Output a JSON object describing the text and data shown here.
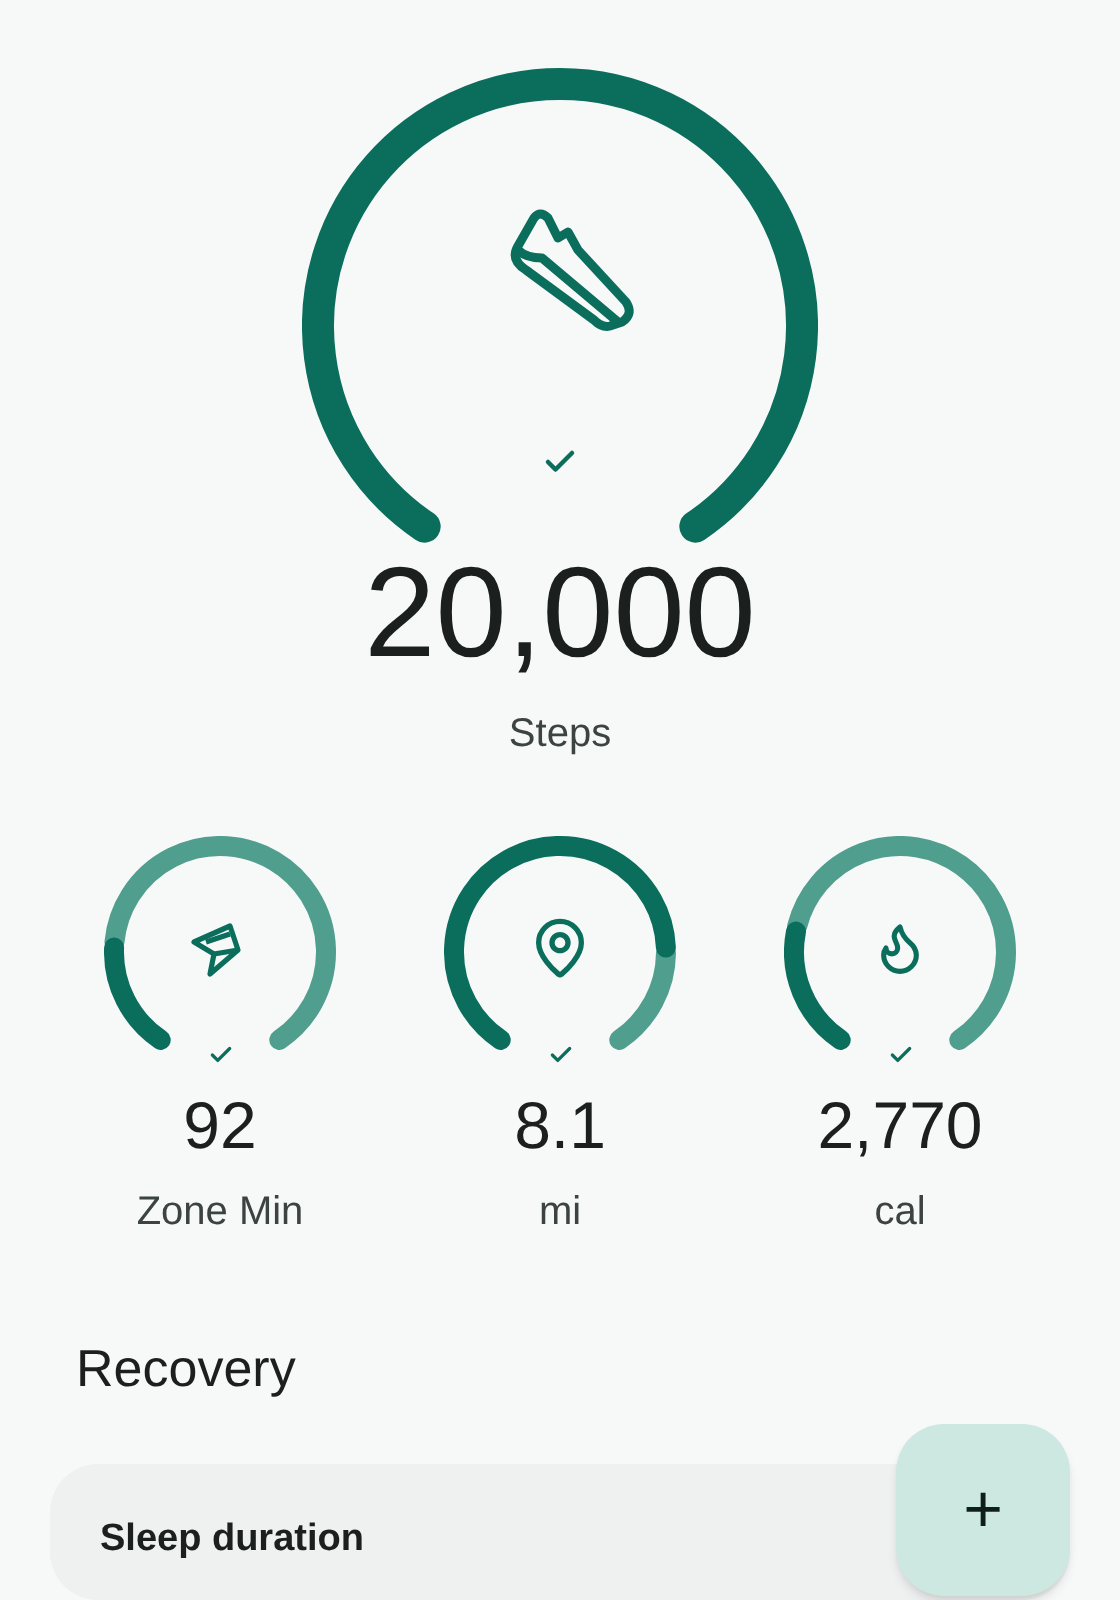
{
  "main_goal": {
    "value": "20,000",
    "label": "Steps",
    "goal_met": true
  },
  "metrics": [
    {
      "kind": "zone",
      "value": "92",
      "label": "Zone Min",
      "goal_met": true
    },
    {
      "kind": "distance",
      "value": "8.1",
      "label": "mi",
      "goal_met": true
    },
    {
      "kind": "calories",
      "value": "2,770",
      "label": "cal",
      "goal_met": true
    }
  ],
  "section_title": "Recovery",
  "cards": [
    {
      "title": "Sleep duration"
    }
  ],
  "fab": {
    "label": "+"
  }
}
